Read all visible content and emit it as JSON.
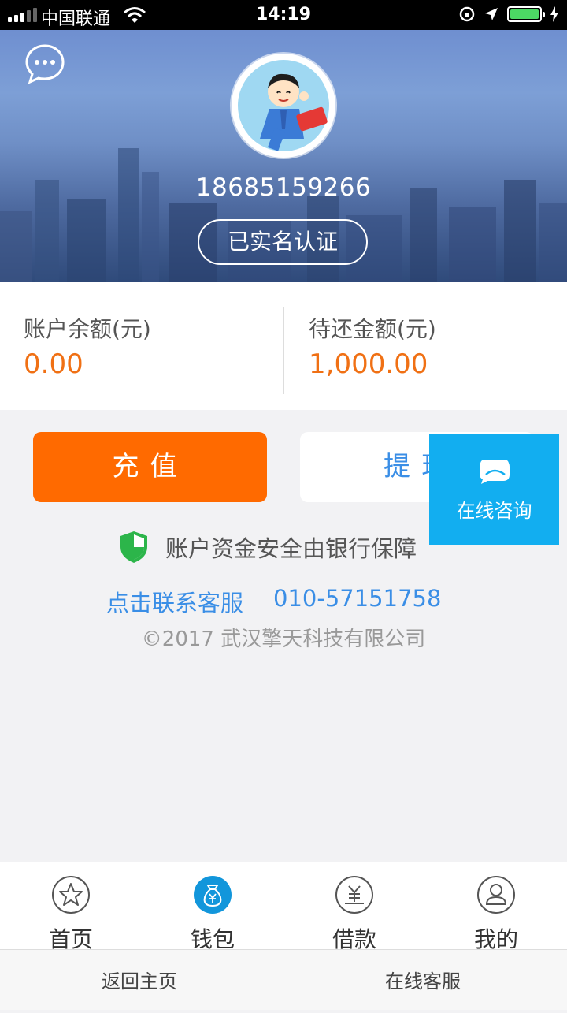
{
  "status_bar": {
    "carrier": "中国联通",
    "time": "14:19"
  },
  "header": {
    "phone": "18685159266",
    "verified_label": "已实名认证"
  },
  "account": {
    "balance_label": "账户余额(元)",
    "balance_value": "0.00",
    "due_label": "待还金额(元)",
    "due_value": "1,000.00"
  },
  "actions": {
    "recharge_label": "充值",
    "withdraw_label": "提现"
  },
  "floating": {
    "consult_label": "在线咨询"
  },
  "info": {
    "safety_text": "账户资金安全由银行保障",
    "contact_link": "点击联系客服",
    "contact_phone": "010-57151758",
    "copyright": "©2017 武汉擎天科技有限公司"
  },
  "tabs": [
    {
      "label": "首页",
      "icon": "star-icon"
    },
    {
      "label": "钱包",
      "icon": "money-bag-icon",
      "active": true
    },
    {
      "label": "借款",
      "icon": "yuan-coin-icon"
    },
    {
      "label": "我的",
      "icon": "user-icon"
    }
  ],
  "bottom_bar": {
    "home_label": "返回主页",
    "service_label": "在线客服"
  },
  "colors": {
    "accent_orange": "#ff6a00",
    "link_blue": "#3a8ee6",
    "consult_blue": "#12aef0",
    "tab_active": "#1296db"
  }
}
